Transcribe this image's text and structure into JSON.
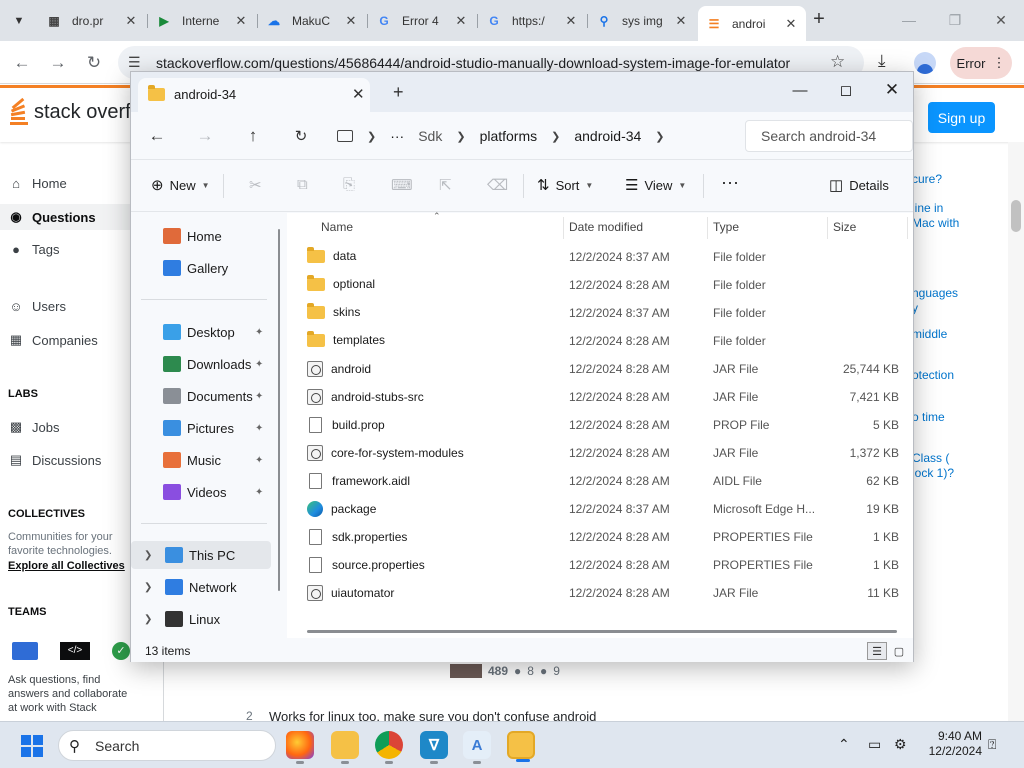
{
  "browser": {
    "tabs": [
      {
        "title": "dro.pr",
        "icon": "document-favicon-icon"
      },
      {
        "title": "Interne",
        "icon": "play-favicon-icon"
      },
      {
        "title": "MakuC",
        "icon": "cloud-favicon-icon"
      },
      {
        "title": "Error 4",
        "icon": "google-favicon-icon"
      },
      {
        "title": "https:/",
        "icon": "google-favicon-icon"
      },
      {
        "title": "sys img",
        "icon": "search-favicon-icon"
      },
      {
        "title": "androi",
        "icon": "stackoverflow-favicon-icon",
        "active": true
      }
    ],
    "url": "stackoverflow.com/questions/45686444/android-studio-manually-download-system-image-for-emulator",
    "error_label": "Error"
  },
  "stackoverflow": {
    "logo_text": "stack overfl",
    "signup_label": "Sign up",
    "nav": [
      {
        "label": "Home",
        "icon": "home-icon"
      },
      {
        "label": "Questions",
        "icon": "globe-icon",
        "selected": true
      },
      {
        "label": "Tags",
        "icon": "tag-icon"
      },
      {
        "label": "Users",
        "icon": "users-icon"
      },
      {
        "label": "Companies",
        "icon": "building-icon"
      }
    ],
    "labs_heading": "LABS",
    "labs": [
      {
        "label": "Jobs",
        "icon": "briefcase-icon"
      },
      {
        "label": "Discussions",
        "icon": "chat-icon"
      }
    ],
    "collectives_heading": "COLLECTIVES",
    "collectives_text": "Communities for your favorite technologies.",
    "collectives_link": "Explore all Collectives",
    "teams_heading": "TEAMS",
    "teams_text": "Ask questions, find answers and collaborate at work with Stack",
    "right_snippets": [
      "cure?",
      "line in",
      "Mac with",
      "nguages",
      "y",
      "middle",
      "otection",
      "o time",
      "Class (",
      "lock 1)?"
    ],
    "votes": {
      "rep": "489",
      "silver": "8",
      "bronze": "9"
    },
    "answer_num": "2",
    "answer_text": "Works for linux too, make sure you don't confuse android"
  },
  "explorer": {
    "tab_title": "android-34",
    "breadcrumb": [
      "Sdk",
      "platforms",
      "android-34"
    ],
    "search_placeholder": "Search android-34",
    "commands": {
      "new": "New",
      "sort": "Sort",
      "view": "View",
      "details": "Details"
    },
    "nav": [
      {
        "label": "Home",
        "icon": "home-icon"
      },
      {
        "label": "Gallery",
        "icon": "gallery-icon"
      },
      {
        "label": "Desktop",
        "icon": "desktop-icon",
        "pinned": true
      },
      {
        "label": "Downloads",
        "icon": "download-icon",
        "pinned": true
      },
      {
        "label": "Documents",
        "icon": "documents-icon",
        "pinned": true
      },
      {
        "label": "Pictures",
        "icon": "pictures-icon",
        "pinned": true
      },
      {
        "label": "Music",
        "icon": "music-icon",
        "pinned": true
      },
      {
        "label": "Videos",
        "icon": "videos-icon",
        "pinned": true
      },
      {
        "label": "This PC",
        "icon": "this-pc-icon",
        "selected": true
      },
      {
        "label": "Network",
        "icon": "network-icon"
      },
      {
        "label": "Linux",
        "icon": "linux-icon"
      }
    ],
    "columns": [
      "Name",
      "Date modified",
      "Type",
      "Size"
    ],
    "files": [
      {
        "name": "data",
        "date": "12/2/2024 8:37 AM",
        "type": "File folder",
        "size": "",
        "icon": "folder"
      },
      {
        "name": "optional",
        "date": "12/2/2024 8:28 AM",
        "type": "File folder",
        "size": "",
        "icon": "folder"
      },
      {
        "name": "skins",
        "date": "12/2/2024 8:37 AM",
        "type": "File folder",
        "size": "",
        "icon": "folder"
      },
      {
        "name": "templates",
        "date": "12/2/2024 8:28 AM",
        "type": "File folder",
        "size": "",
        "icon": "folder"
      },
      {
        "name": "android",
        "date": "12/2/2024 8:28 AM",
        "type": "JAR File",
        "size": "25,744 KB",
        "icon": "jar"
      },
      {
        "name": "android-stubs-src",
        "date": "12/2/2024 8:28 AM",
        "type": "JAR File",
        "size": "7,421 KB",
        "icon": "jar"
      },
      {
        "name": "build.prop",
        "date": "12/2/2024 8:28 AM",
        "type": "PROP File",
        "size": "5 KB",
        "icon": "doc"
      },
      {
        "name": "core-for-system-modules",
        "date": "12/2/2024 8:28 AM",
        "type": "JAR File",
        "size": "1,372 KB",
        "icon": "jar"
      },
      {
        "name": "framework.aidl",
        "date": "12/2/2024 8:28 AM",
        "type": "AIDL File",
        "size": "62 KB",
        "icon": "doc"
      },
      {
        "name": "package",
        "date": "12/2/2024 8:37 AM",
        "type": "Microsoft Edge H...",
        "size": "19 KB",
        "icon": "edge"
      },
      {
        "name": "sdk.properties",
        "date": "12/2/2024 8:28 AM",
        "type": "PROPERTIES File",
        "size": "1 KB",
        "icon": "doc"
      },
      {
        "name": "source.properties",
        "date": "12/2/2024 8:28 AM",
        "type": "PROPERTIES File",
        "size": "1 KB",
        "icon": "doc"
      },
      {
        "name": "uiautomator",
        "date": "12/2/2024 8:28 AM",
        "type": "JAR File",
        "size": "11 KB",
        "icon": "jar"
      }
    ],
    "status": "13 items"
  },
  "taskbar": {
    "search_label": "Search",
    "apps": [
      "firefox-icon",
      "file-explorer-icon",
      "chrome-icon",
      "vs-code-icon",
      "android-studio-icon",
      "file-explorer-active-icon"
    ],
    "time": "9:40 AM",
    "date": "12/2/2024"
  }
}
